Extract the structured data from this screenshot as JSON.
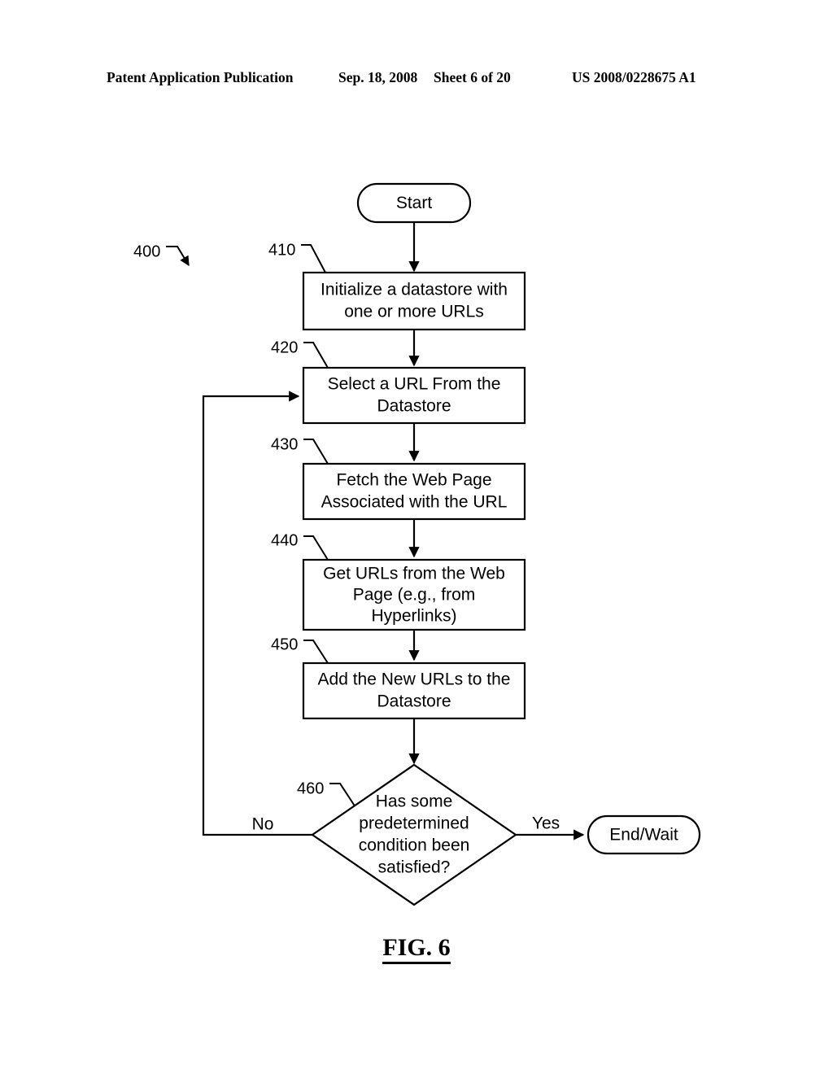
{
  "header": {
    "publication": "Patent Application Publication",
    "date": "Sep. 18, 2008",
    "sheet": "Sheet 6 of 20",
    "patent_number": "US 2008/0228675 A1"
  },
  "figure": {
    "caption": "FIG. 6",
    "diagram_reference": "400"
  },
  "nodes": {
    "start": {
      "ref": "",
      "label": "Start"
    },
    "step410": {
      "ref": "410",
      "line1": "Initialize a datastore with",
      "line2": "one or more URLs"
    },
    "step420": {
      "ref": "420",
      "line1": "Select a URL From the",
      "line2": "Datastore"
    },
    "step430": {
      "ref": "430",
      "line1": "Fetch the Web Page",
      "line2": "Associated with the URL"
    },
    "step440": {
      "ref": "440",
      "line1": "Get URLs from the Web",
      "line2": "Page (e.g., from",
      "line3": "Hyperlinks)"
    },
    "step450": {
      "ref": "450",
      "line1": "Add the New URLs to the",
      "line2": "Datastore"
    },
    "decision460": {
      "ref": "460",
      "line1": "Has some",
      "line2": "predetermined",
      "line3": "condition been",
      "line4": "satisfied?"
    },
    "end": {
      "label": "End/Wait"
    }
  },
  "branches": {
    "no": "No",
    "yes": "Yes"
  },
  "colors": {
    "ink": "#000000",
    "paper": "#ffffff"
  }
}
